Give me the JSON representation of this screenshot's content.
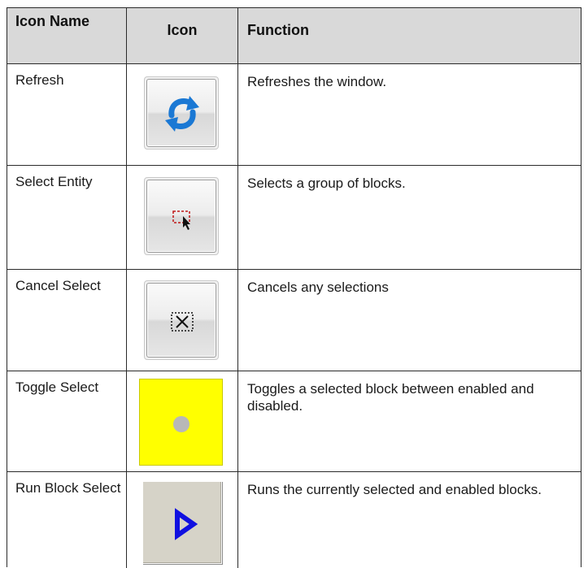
{
  "table": {
    "headers": {
      "name": "Icon Name",
      "icon": "Icon",
      "function": "Function"
    },
    "rows": [
      {
        "name": "Refresh",
        "icon": "refresh-icon",
        "function": "Refreshes the window."
      },
      {
        "name": "Select Entity",
        "icon": "select-entity-icon",
        "function": "Selects a group of blocks."
      },
      {
        "name": "Cancel Select",
        "icon": "cancel-select-icon",
        "function": "Cancels any selections"
      },
      {
        "name": "Toggle Select",
        "icon": "toggle-select-icon",
        "function": "Toggles a selected block between enabled and disabled."
      },
      {
        "name": "Run Block Select",
        "icon": "run-block-select-icon",
        "function": "Runs the currently selected and enabled blocks."
      }
    ]
  },
  "colors": {
    "header_bg": "#d9d9d9",
    "refresh_arrow": "#1a78d4",
    "select_dash": "#c01818",
    "toggle_bg": "#ffff00",
    "toggle_dot": "#b8b8b8",
    "run_arrow": "#1010e0"
  }
}
